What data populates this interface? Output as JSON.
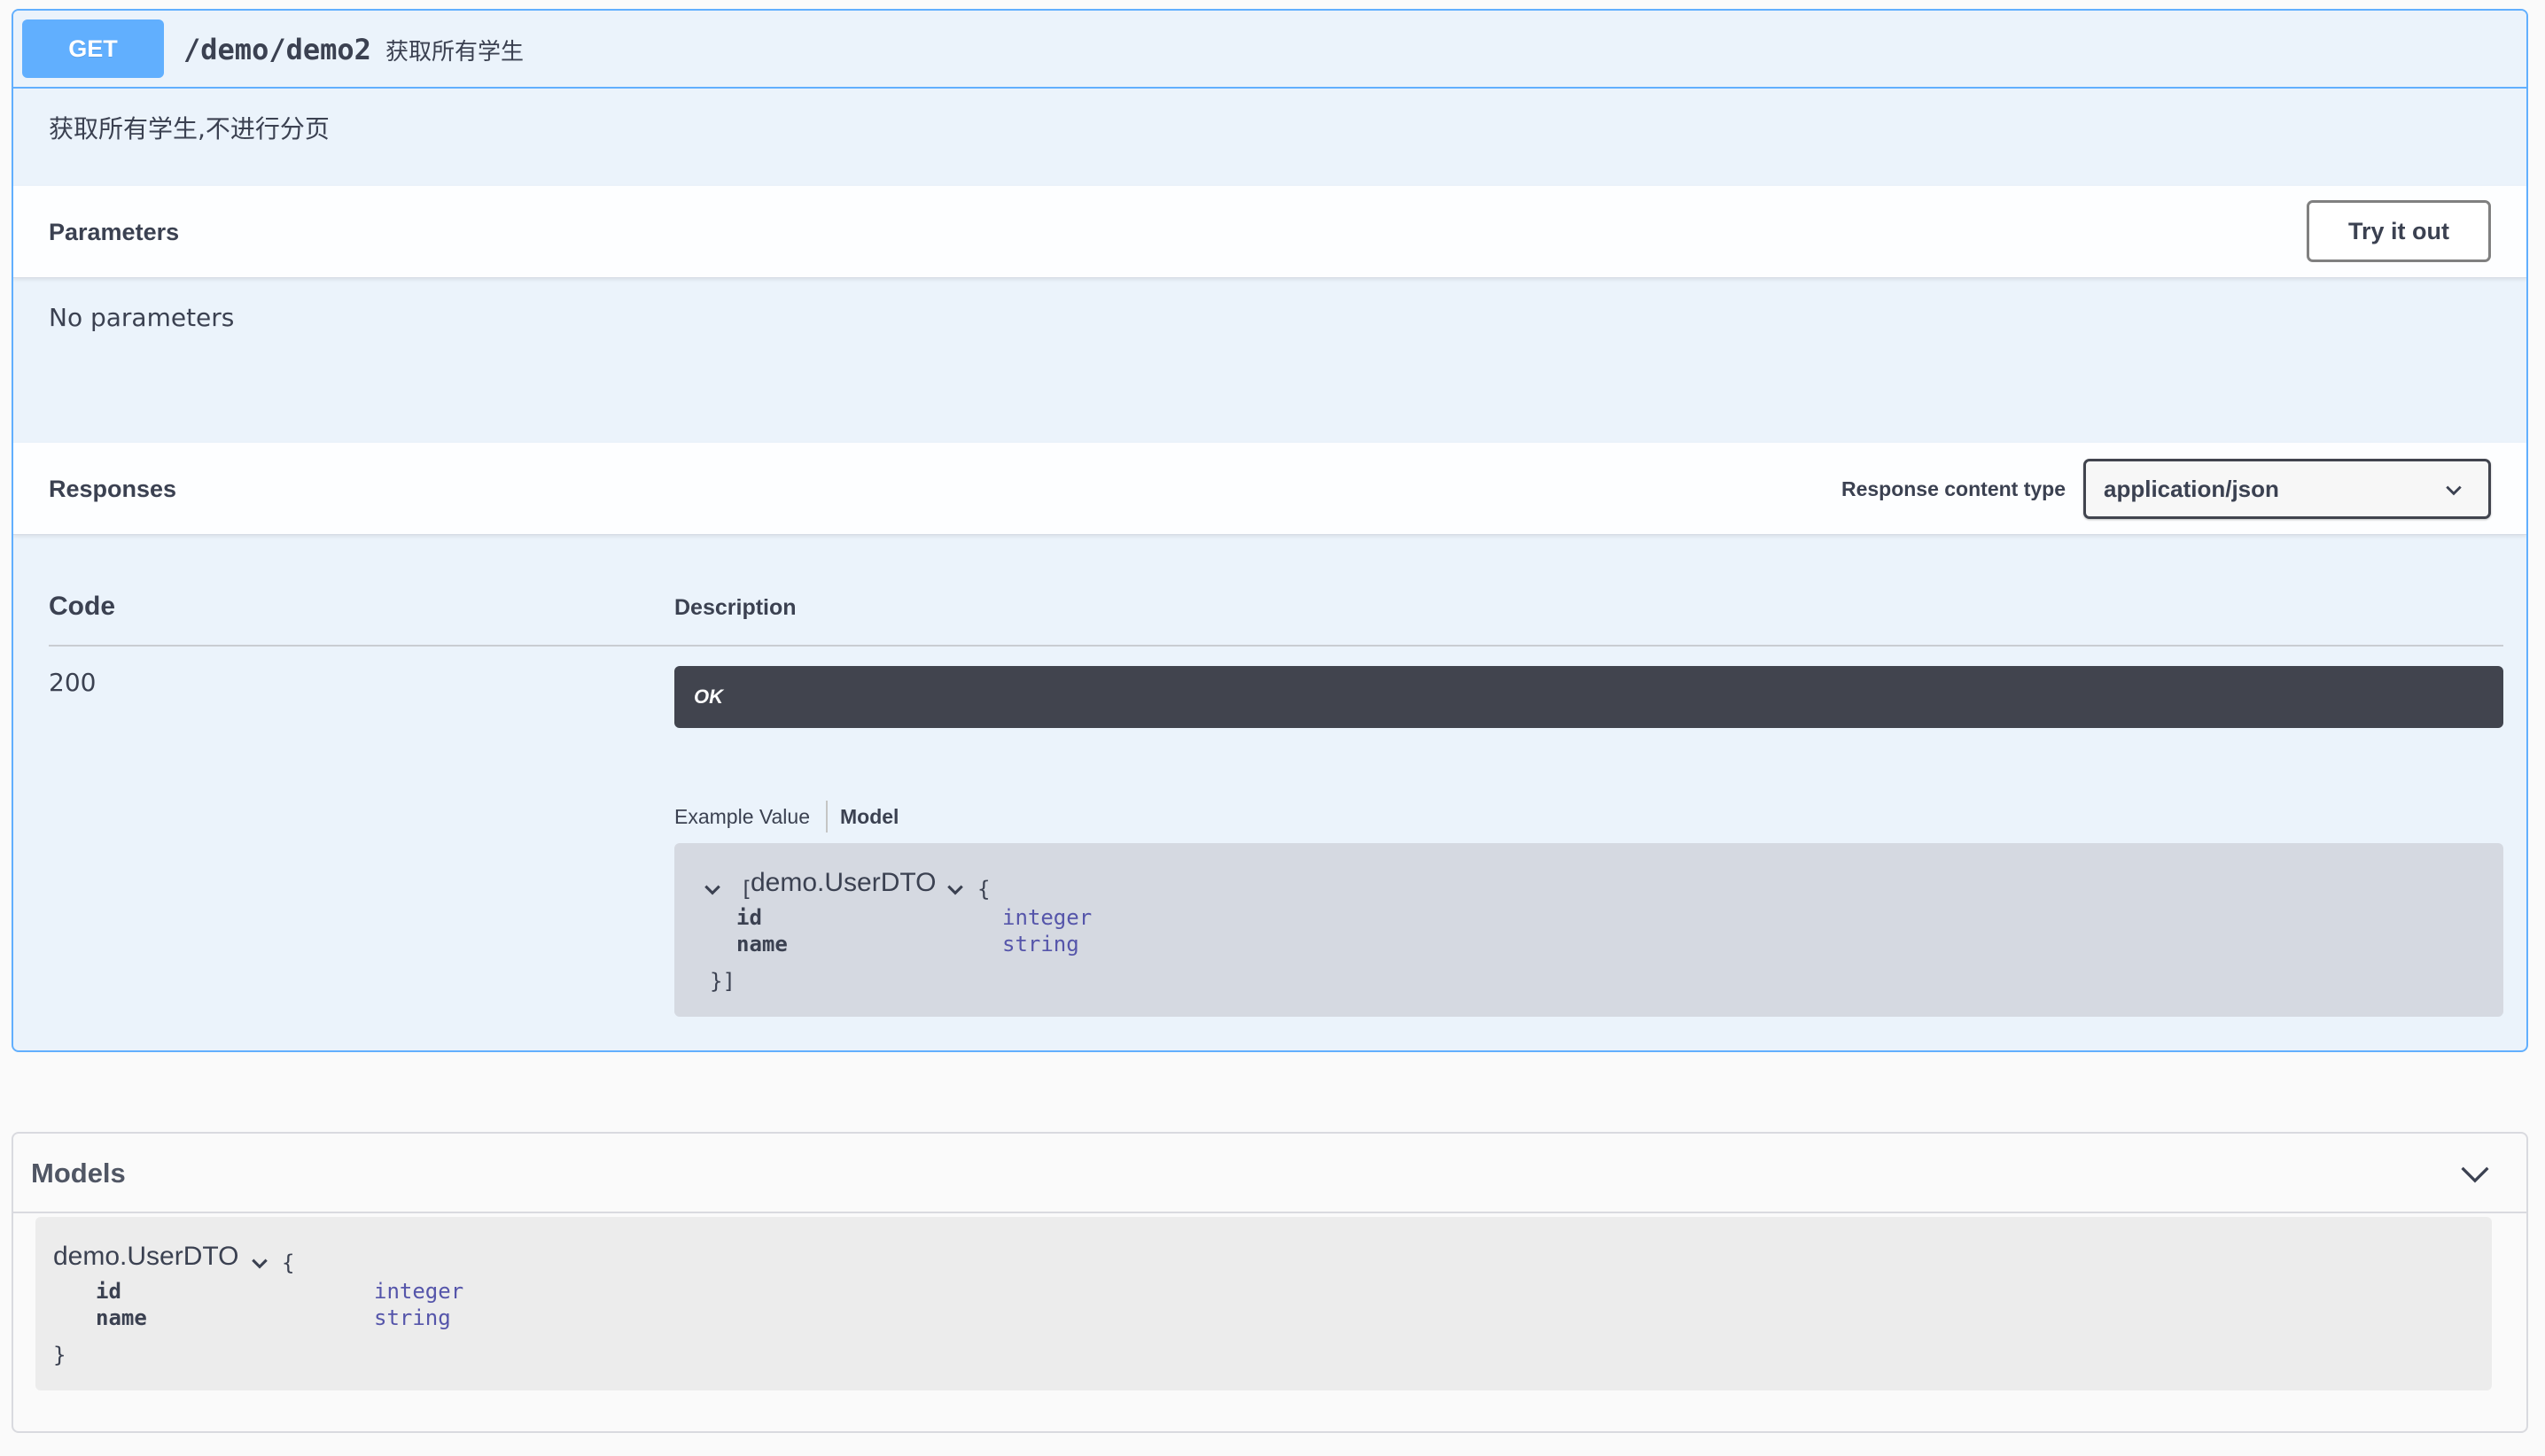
{
  "operation": {
    "method": "GET",
    "path": "/demo/demo2",
    "summary": "获取所有学生",
    "description": "获取所有学生,不进行分页"
  },
  "parameters": {
    "title": "Parameters",
    "try_label": "Try it out",
    "empty_text": "No parameters"
  },
  "responses": {
    "title": "Responses",
    "content_type_label": "Response content type",
    "content_type_value": "application/json",
    "col_code": "Code",
    "col_description": "Description",
    "rows": [
      {
        "code": "200",
        "description": "OK",
        "tabs": [
          "Example Value",
          "Model"
        ],
        "model": {
          "open": "[",
          "name": "demo.UserDTO",
          "brace_open": "{",
          "fields": [
            {
              "name": "id",
              "type": "integer"
            },
            {
              "name": "name",
              "type": "string"
            }
          ],
          "close": "}]"
        }
      }
    ]
  },
  "models": {
    "title": "Models",
    "items": [
      {
        "name": "demo.UserDTO",
        "brace_open": "{",
        "fields": [
          {
            "name": "id",
            "type": "integer"
          },
          {
            "name": "name",
            "type": "string"
          }
        ],
        "close": "}"
      }
    ]
  },
  "colors": {
    "get_accent": "#61affe",
    "get_bg": "#ebf3fb",
    "ok_bar": "#41444e",
    "type_text": "#55a"
  },
  "icons": {
    "select": "chevron-down-icon",
    "model_toggle": "chevron-down-icon",
    "models_toggle": "chevron-down-icon"
  }
}
